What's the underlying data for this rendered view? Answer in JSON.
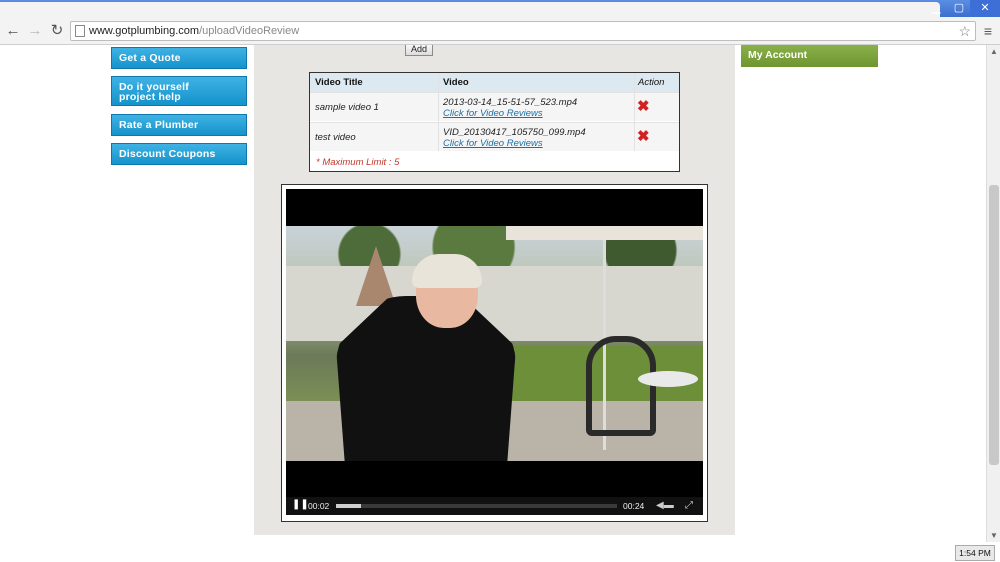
{
  "browser": {
    "url_host": "www.gotplumbing.com",
    "url_path": "/uploadVideoReview"
  },
  "sidebar": {
    "items": [
      {
        "label": "Get a Quote"
      },
      {
        "label": "Do it yourself project help"
      },
      {
        "label": "Rate a Plumber"
      },
      {
        "label": "Discount Coupons"
      }
    ]
  },
  "account": {
    "label": "My Account"
  },
  "upload": {
    "add_label": "Add"
  },
  "video_table": {
    "headers": {
      "title": "Video Title",
      "video": "Video",
      "action": "Action"
    },
    "rows": [
      {
        "title": "sample video 1",
        "file": "2013-03-14_15-51-57_523.mp4",
        "link": "Click for Video Reviews"
      },
      {
        "title": "test video",
        "file": "VID_20130417_105750_099.mp4",
        "link": "Click for Video Reviews"
      }
    ],
    "limit_text": "* Maximum Limit : 5"
  },
  "player": {
    "current_time": "00:02",
    "duration": "00:24",
    "progress_fraction": 0.09
  },
  "taskbar": {
    "clock": "1:54 PM"
  },
  "colors": {
    "sidebar_button": "#1fa3d8",
    "account_button": "#7aa13a",
    "delete_icon": "#d02222",
    "link": "#1a6fa8"
  }
}
